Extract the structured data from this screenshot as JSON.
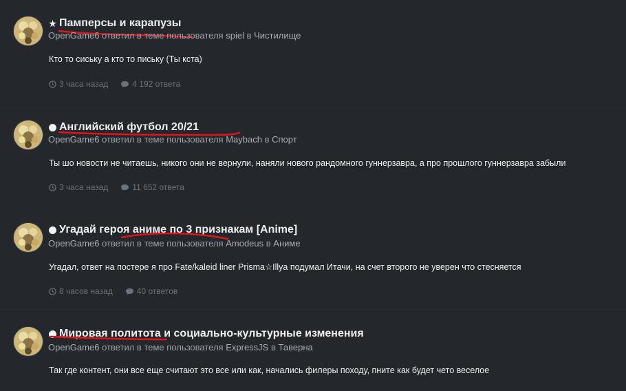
{
  "posts": [
    {
      "icon": "star-icon",
      "title": "Памперсы и карапузы",
      "author": "OpenGame6",
      "action": "ответил в теме пользователя",
      "topic_author": "spiel",
      "in": "в",
      "forum": "Чистилище",
      "body": "Кто то сиську а кто то письку (Ты кста)",
      "time": "3 часа назад",
      "replies": "4 192 ответа"
    },
    {
      "icon": "dot-icon",
      "title": "Английский футбол 20/21",
      "author": "OpenGame6",
      "action": "ответил в теме пользователя",
      "topic_author": "Maybach",
      "in": "в",
      "forum": "Спорт",
      "body": "Ты шо новости не читаешь, никого они не вернули, наняли нового рандомного гуннерзавра, а про прошлого гуннерзавра забыли",
      "time": "3 часа назад",
      "replies": "11 652 ответа"
    },
    {
      "icon": "dot-icon",
      "title": "Угадай героя аниме по 3 признакам [Anime]",
      "author": "OpenGame6",
      "action": "ответил в теме пользователя",
      "topic_author": "Amodeus",
      "in": "в",
      "forum": "Аниме",
      "body": "Угадал, ответ на постере я про Fate/kaleid liner Prisma☆Illya подумал Итачи, на счет второго не уверен что стесняется",
      "time": "8 часов назад",
      "replies": "40 ответов"
    },
    {
      "icon": "dot-icon",
      "title": "Мировая политота и социально-культурные изменения",
      "author": "OpenGame6",
      "action": "ответил в теме пользователя",
      "topic_author": "ExpressJS",
      "in": "в",
      "forum": "Таверна",
      "body": "Так где контент, они все еще считают это все или как, начались филеры походу, пните как будет чето веселое",
      "time": "",
      "replies": ""
    }
  ],
  "colors": {
    "background": "#24272c",
    "annotation": "#e0141a",
    "title": "#eceef0",
    "meta": "#9da3ab",
    "stats": "#6b727b"
  }
}
